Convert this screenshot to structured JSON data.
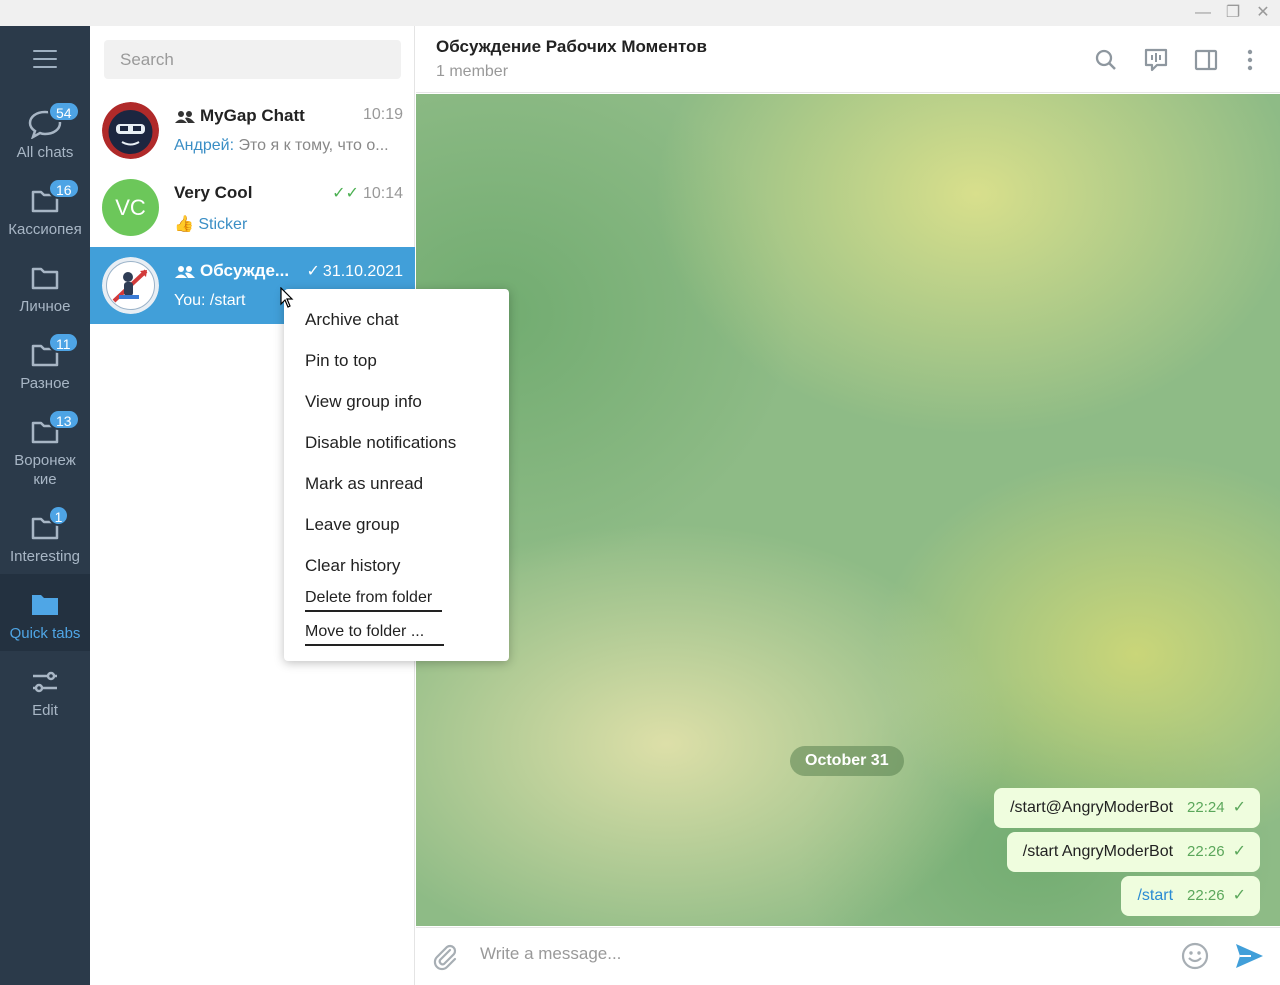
{
  "window": {
    "controls": {
      "minimize": "—",
      "restore": "❐",
      "close": "✕"
    }
  },
  "folders": [
    {
      "label": "All chats",
      "badge": "54",
      "icon": "chat-bubble-icon"
    },
    {
      "label": "Кассиопея",
      "badge": "16",
      "icon": "folder-icon"
    },
    {
      "label": "Личное",
      "badge": "",
      "icon": "folder-icon"
    },
    {
      "label": "Разное",
      "badge": "11",
      "icon": "folder-icon"
    },
    {
      "label": "Воронеж\nкие",
      "label_line1": "Воронеж",
      "label_line2": "кие",
      "badge": "13",
      "icon": "folder-icon"
    },
    {
      "label": "Interesting",
      "badge": "1",
      "icon": "folder-icon"
    },
    {
      "label": "Quick tabs",
      "badge": "",
      "icon": "folder-filled-icon",
      "active": true
    },
    {
      "label": "Edit",
      "badge": "",
      "icon": "sliders-icon"
    }
  ],
  "search": {
    "placeholder": "Search"
  },
  "chats": [
    {
      "name": "MyGap Chatt",
      "time": "10:19",
      "sender": "Андрей:",
      "preview": "Это я к тому, что о...",
      "group": true
    },
    {
      "name": "Very Cool",
      "initials": "VC",
      "time": "10:14",
      "preview": "Sticker",
      "emoji": "👍",
      "read": true
    },
    {
      "name": "Обсужде...",
      "time": "31.10.2021",
      "preview": "You: /start",
      "group": true,
      "active": true
    }
  ],
  "header": {
    "title": "Обсуждение Рабочих Моментов",
    "subtitle": "1 member"
  },
  "messages": {
    "date": "October 31",
    "items": [
      {
        "text": "/start@AngryModerBot",
        "time": "22:24"
      },
      {
        "text": "/start AngryModerBot",
        "time": "22:26"
      },
      {
        "text": "/start",
        "time": "22:26",
        "command": true
      }
    ]
  },
  "compose": {
    "placeholder": "Write a message..."
  },
  "context_menu": [
    "Archive chat",
    "Pin to top",
    "View group info",
    "Disable notifications",
    "Mark as unread",
    "Leave group",
    "Clear history",
    "Delete from folder",
    "Move to folder ..."
  ],
  "colors": {
    "accent": "#419fd9",
    "sidebar": "#2b3a4a",
    "badge": "#4ea4e5",
    "outgoing": "#effdde"
  }
}
